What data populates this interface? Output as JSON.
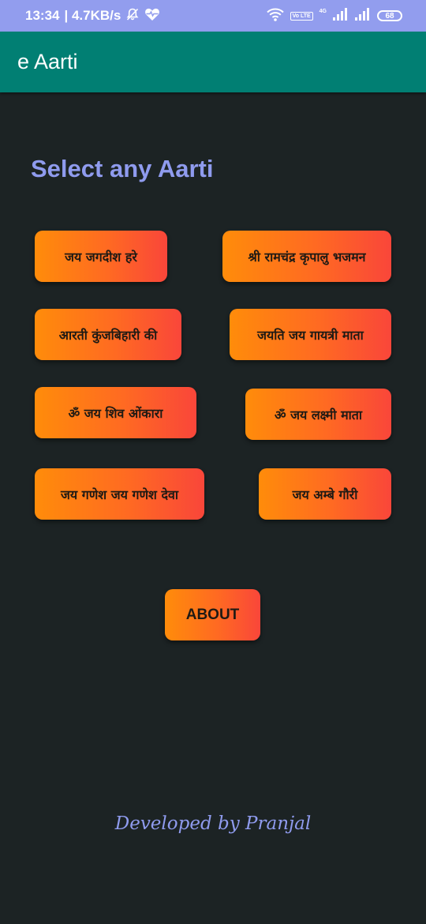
{
  "status_bar": {
    "time": "13:34",
    "speed": "| 4.7KB/s",
    "volte": "Vo LTE",
    "network": "4G",
    "battery": "68"
  },
  "app_bar": {
    "title": "e Aarti"
  },
  "heading": "Select any Aarti",
  "aartis": [
    "जय जगदीश हरे",
    "श्री रामचंद्र कृपालु भजमन",
    "आरती कुंजबिहारी की",
    "जयति जय गायत्री माता",
    "ॐ जय शिव ओंकारा",
    "ॐ जय लक्ष्मी माता",
    "जय गणेश जय गणेश देवा",
    "जय अम्बे गौरी"
  ],
  "about_label": "ABOUT",
  "footer": "Developed by Pranjal",
  "colors": {
    "status_bar": "#929dee",
    "app_bar": "#017f73",
    "background": "#1c2324",
    "accent_text": "#8f9bee",
    "button_gradient_start": "#ff8c0a",
    "button_gradient_end": "#f9463a"
  },
  "icons": [
    "bell-off-icon",
    "heart-pulse-icon",
    "wifi-icon",
    "signal-icon",
    "battery-icon"
  ]
}
